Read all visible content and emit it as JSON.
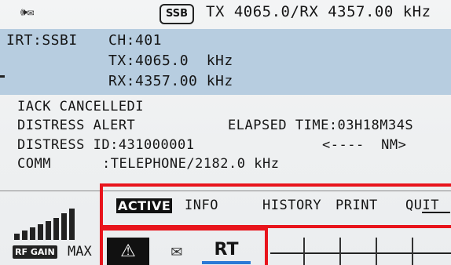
{
  "status_bar": {
    "icons": [
      "speaker-icon",
      "envelope-icon"
    ],
    "mode": "SSB",
    "frequency_readout": "TX 4065.0/RX 4357.00 kHz"
  },
  "channel_panel": {
    "source": "IRT:SSBI",
    "channel": "CH:401",
    "tx": "TX:4065.0  kHz",
    "rx": "RX:4357.00 kHz"
  },
  "message": {
    "status": "IACK CANCELLEDI",
    "alert": "DISTRESS ALERT",
    "elapsed": "ELAPSED TIME:03H18M34S",
    "distress_id": "DISTRESS ID:431000001",
    "nm": "<----  NM>",
    "comm_label": "COMM",
    "comm_value": ":TELEPHONE/2182.0 kHz"
  },
  "menu": {
    "items": [
      "ACTIVE",
      "INFO",
      "HISTORY",
      "PRINT",
      "QUIT"
    ],
    "selected": "ACTIVE"
  },
  "rf_gain": {
    "badge": "RF GAIN",
    "value": "MAX",
    "level_bars": 8
  },
  "softkeys": {
    "rt_label": "RT",
    "icons": [
      "distress-alert-icon",
      "mail-icon"
    ]
  },
  "colors": {
    "highlight_box": "#e8141c",
    "panel_blue": "#b7cde0",
    "rt_underline": "#2a7ad6"
  }
}
